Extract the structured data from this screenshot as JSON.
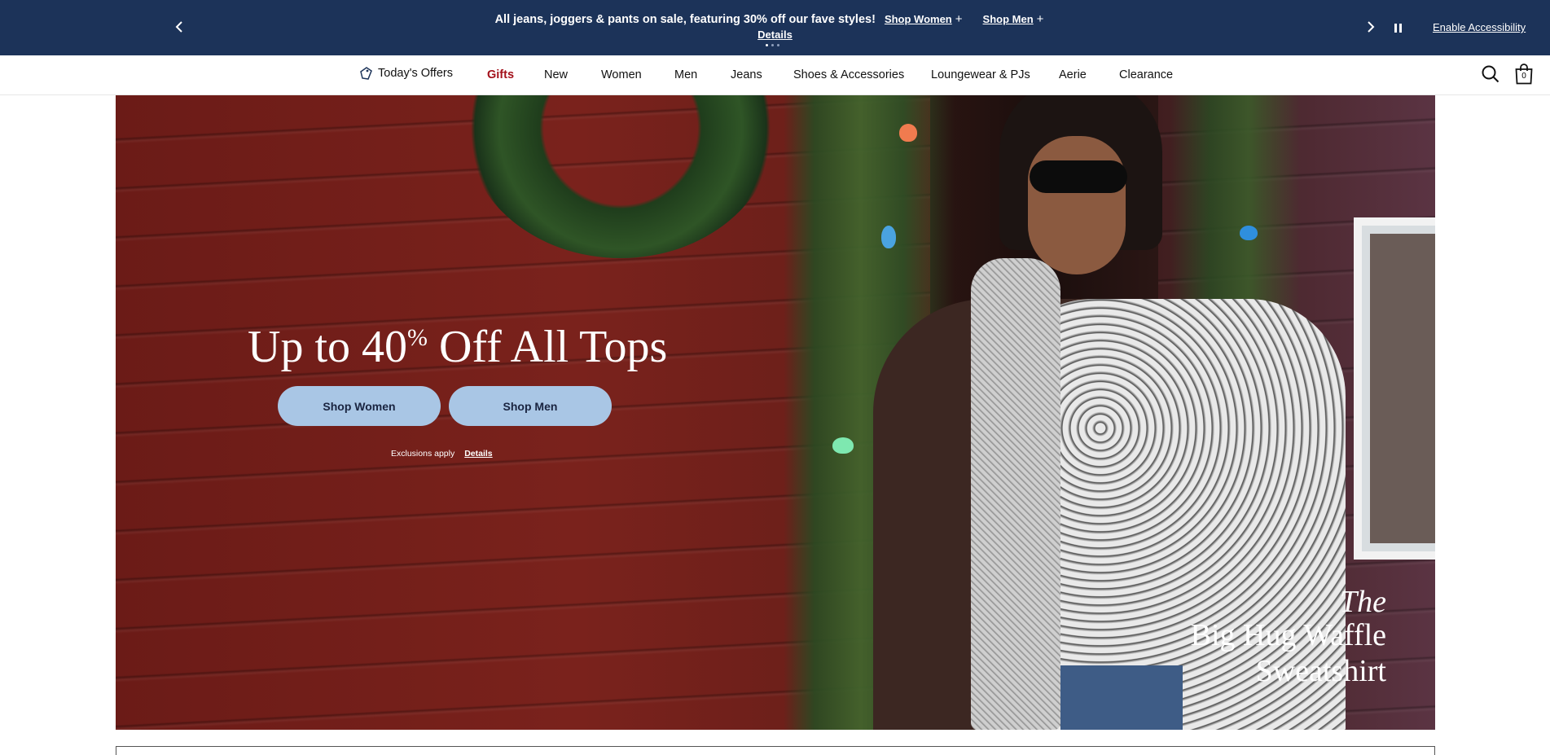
{
  "promo": {
    "message": "All jeans, joggers & pants on sale, featuring 30% off our fave styles!",
    "shop_women": "Shop Women",
    "shop_men": "Shop Men",
    "plus": "+",
    "details": "Details",
    "slide_count": 3,
    "active_slide": 1
  },
  "accessibility": {
    "label": "Enable Accessibility"
  },
  "nav": {
    "offers": "Today's Offers",
    "items": [
      "Gifts",
      "New",
      "Women",
      "Men",
      "Jeans",
      "Shoes & Accessories",
      "Loungewear & PJs",
      "Aerie",
      "Clearance"
    ],
    "bag_count": "0"
  },
  "hero": {
    "title_prefix": "Up to 40",
    "title_percent": "%",
    "title_suffix": " Off All Tops",
    "btn_women": "Shop Women",
    "btn_men": "Shop Men",
    "exclusions": "Exclusions apply",
    "details": "Details",
    "caption_the": "The",
    "caption_line1": "Big Hug Waffle",
    "caption_line2": "Sweatshirt"
  },
  "colors": {
    "promo_bg": "#1c3359",
    "gifts": "#a3101a",
    "hero_button": "#a9c6e5"
  }
}
